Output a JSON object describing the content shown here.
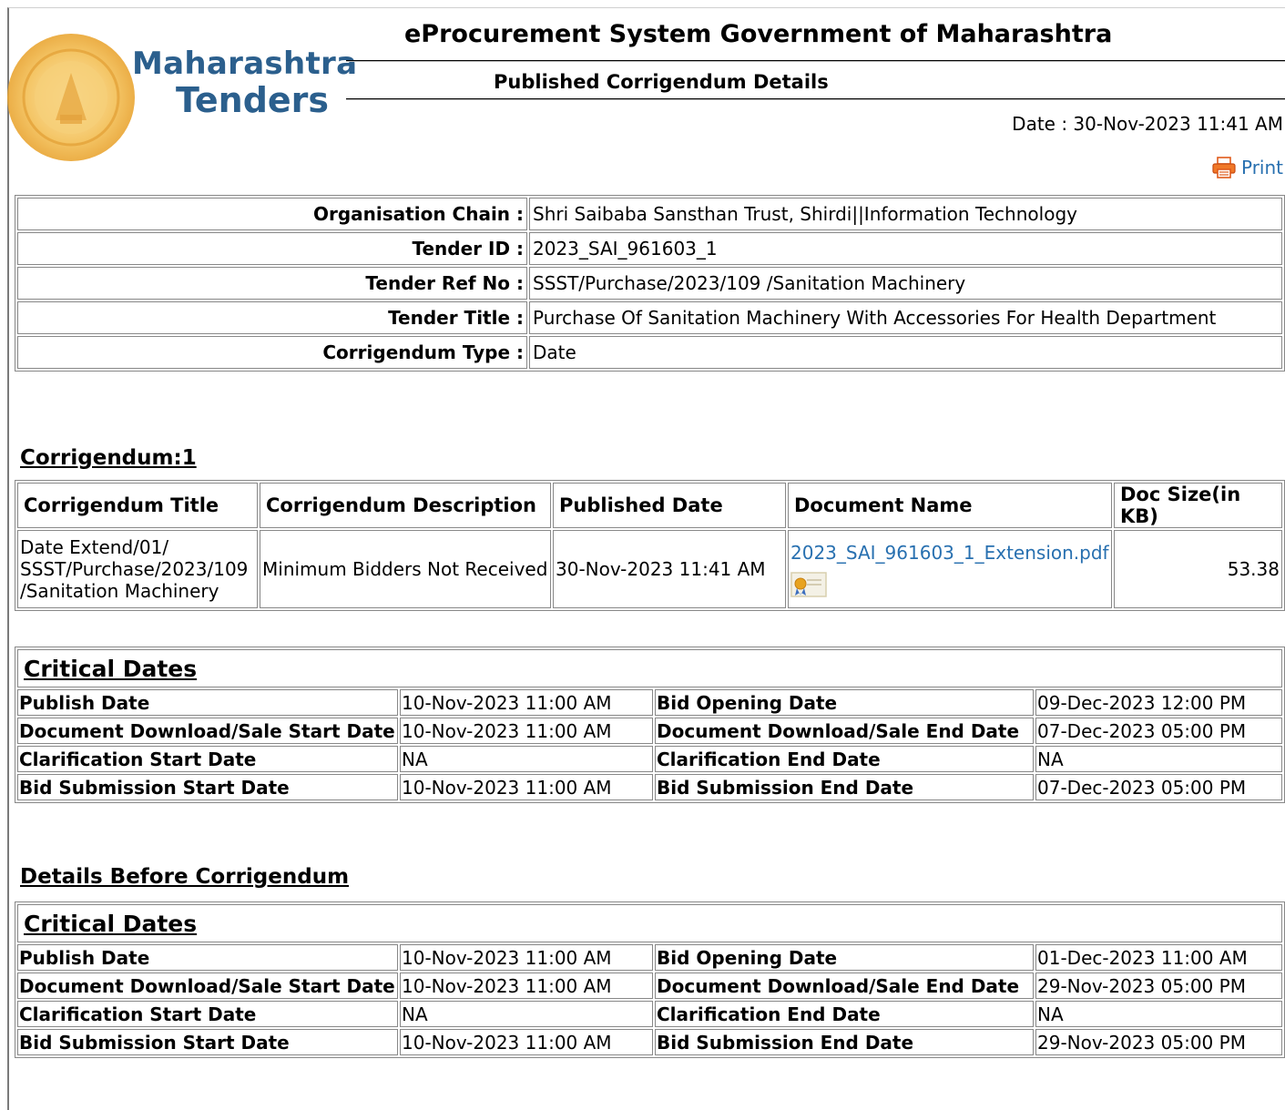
{
  "header": {
    "brand_line1": "Maharashtra",
    "brand_line2": "Tenders",
    "site_title": "eProcurement System Government of Maharashtra",
    "page_title": "Published Corrigendum Details",
    "date_text": "Date : 30-Nov-2023 11:41 AM",
    "print_label": "Print",
    "print_icon": "printer-icon",
    "logo_icon": "maharashtra-seal-logo"
  },
  "tender_info": [
    {
      "label": "Organisation Chain :",
      "value": "Shri Saibaba Sansthan Trust, Shirdi||Information Technology"
    },
    {
      "label": "Tender ID :",
      "value": "2023_SAI_961603_1"
    },
    {
      "label": "Tender Ref No :",
      "value": "SSST/Purchase/2023/109 /Sanitation Machinery"
    },
    {
      "label": "Tender Title :",
      "value": "Purchase Of Sanitation Machinery With Accessories For Health Department"
    },
    {
      "label": "Corrigendum Type :",
      "value": "Date"
    }
  ],
  "corrigendum": {
    "heading": "Corrigendum:1",
    "columns": [
      "Corrigendum Title",
      "Corrigendum Description",
      "Published Date",
      "Document Name",
      "Doc Size(in KB)"
    ],
    "row": {
      "title_line1": "Date Extend/01/",
      "title_line2": "SSST/Purchase/2023/109",
      "title_line3": "/Sanitation Machinery",
      "description": "Minimum Bidders Not Received",
      "published_date": "30-Nov-2023 11:41 AM",
      "document_name": "2023_SAI_961603_1_Extension.pdf",
      "document_icon": "certificate-icon",
      "doc_size": "53.38"
    }
  },
  "critical_dates": {
    "caption": "Critical Dates",
    "rows": [
      {
        "k1": "Publish Date",
        "v1": "10-Nov-2023 11:00 AM",
        "k2": "Bid Opening Date",
        "v2": "09-Dec-2023 12:00 PM"
      },
      {
        "k1": "Document Download/Sale Start Date",
        "v1": "10-Nov-2023 11:00 AM",
        "k2": "Document Download/Sale End Date",
        "v2": "07-Dec-2023 05:00 PM"
      },
      {
        "k1": "Clarification Start Date",
        "v1": "NA",
        "k2": "Clarification End Date",
        "v2": "NA"
      },
      {
        "k1": "Bid Submission Start Date",
        "v1": "10-Nov-2023 11:00 AM",
        "k2": "Bid Submission End Date",
        "v2": "07-Dec-2023 05:00 PM"
      }
    ]
  },
  "before": {
    "heading": "Details Before Corrigendum",
    "caption": "Critical Dates",
    "rows": [
      {
        "k1": "Publish Date",
        "v1": "10-Nov-2023 11:00 AM",
        "k2": "Bid Opening Date",
        "v2": "01-Dec-2023 11:00 AM"
      },
      {
        "k1": "Document Download/Sale Start Date",
        "v1": "10-Nov-2023 11:00 AM",
        "k2": "Document Download/Sale End Date",
        "v2": "29-Nov-2023 05:00 PM"
      },
      {
        "k1": "Clarification Start Date",
        "v1": "NA",
        "k2": "Clarification End Date",
        "v2": "NA"
      },
      {
        "k1": "Bid Submission Start Date",
        "v1": "10-Nov-2023 11:00 AM",
        "k2": "Bid Submission End Date",
        "v2": "29-Nov-2023 05:00 PM"
      }
    ]
  },
  "colors": {
    "brand": "#2b5f8d",
    "link": "#2870b0",
    "seal": "#f0b030"
  }
}
